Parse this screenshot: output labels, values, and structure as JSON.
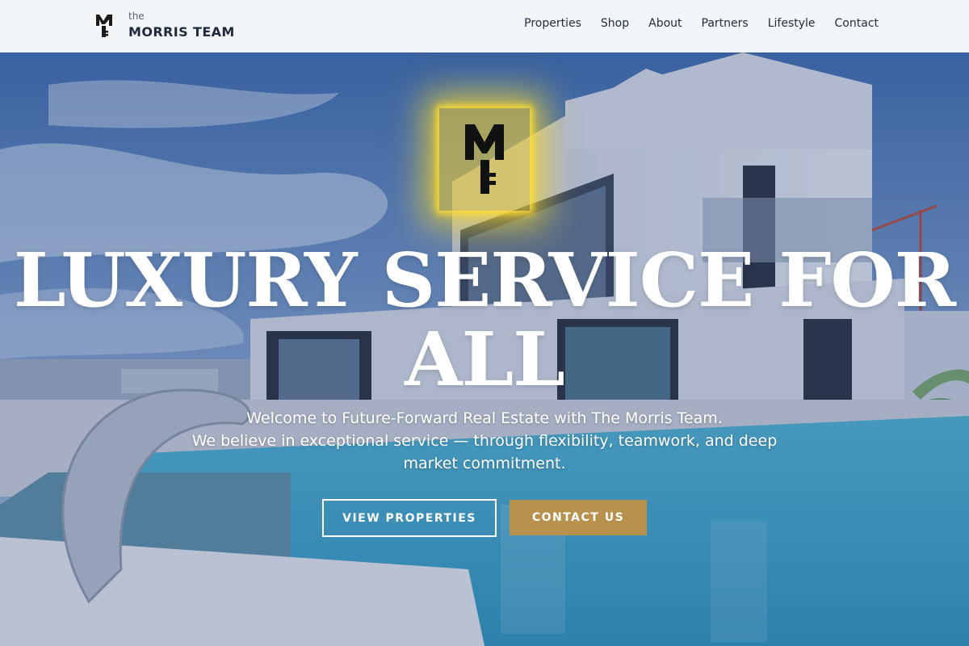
{
  "header": {
    "brand_small": "the",
    "brand_name": "MORRIS TEAM",
    "logo_icon": "mt-key-icon",
    "nav": [
      {
        "label": "Properties"
      },
      {
        "label": "Shop"
      },
      {
        "label": "About"
      },
      {
        "label": "Partners"
      },
      {
        "label": "Lifestyle"
      },
      {
        "label": "Contact"
      }
    ]
  },
  "hero": {
    "title_line1": "LUXURY SERVICE FOR",
    "title_line2": "ALL",
    "subtitle_line1": "Welcome to Future-Forward Real Estate with The Morris Team.",
    "subtitle_line2": "We believe in exceptional service — through flexibility, teamwork, and deep",
    "subtitle_line3": "market commitment.",
    "buttons": {
      "primary_label": "VIEW PROPERTIES",
      "secondary_label": "CONTACT US"
    },
    "logo_icon": "mt-key-icon",
    "background_image": "luxury-house-pool-image"
  },
  "colors": {
    "accent_gold": "#b8914d",
    "logo_glow": "#f6d228",
    "nav_text": "#1f2a3d"
  }
}
